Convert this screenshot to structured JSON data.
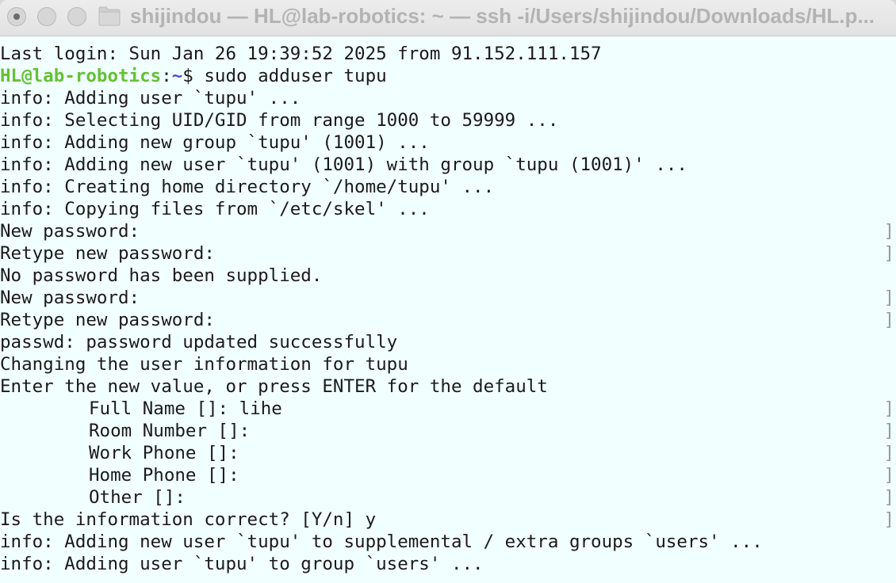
{
  "window": {
    "title": "shijindou — HL@lab-robotics: ~ — ssh -i/Users/shijindou/Downloads/HL.p..."
  },
  "prompt": {
    "user_host": "HL@lab-robotics",
    "sep": ":",
    "path": "~",
    "dollar": "$ ",
    "command": "sudo adduser tupu"
  },
  "lines": {
    "last_login": "Last login: Sun Jan 26 19:39:52 2025 from 91.152.111.157",
    "l1": "info: Adding user `tupu' ...",
    "l2": "info: Selecting UID/GID from range 1000 to 59999 ...",
    "l3": "info: Adding new group `tupu' (1001) ...",
    "l4": "info: Adding new user `tupu' (1001) with group `tupu (1001)' ...",
    "l5": "info: Creating home directory `/home/tupu' ...",
    "l6": "info: Copying files from `/etc/skel' ...",
    "l7": "New password:",
    "l8": "Retype new password:",
    "l9": "No password has been supplied.",
    "l10": "New password:",
    "l11": "Retype new password:",
    "l12": "passwd: password updated successfully",
    "l13": "Changing the user information for tupu",
    "l14": "Enter the new value, or press ENTER for the default",
    "l15": "Full Name []: lihe",
    "l16": "Room Number []:",
    "l17": "Work Phone []:",
    "l18": "Home Phone []:",
    "l19": "Other []:",
    "l20": "Is the information correct? [Y/n] y",
    "l21": "info: Adding new user `tupu' to supplemental / extra groups `users' ...",
    "l22": "info: Adding user `tupu' to group `users' ..."
  },
  "marker": "]",
  "icons": {
    "folder": "folder-icon"
  }
}
